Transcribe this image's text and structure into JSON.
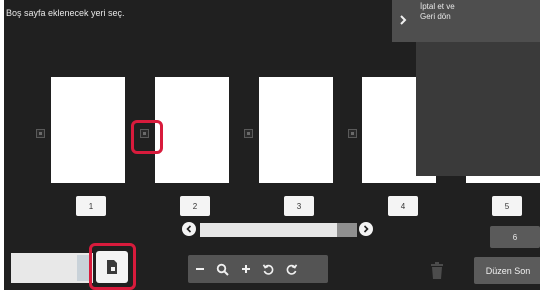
{
  "instruction": "Boş sayfa eklenecek yeri seç.",
  "cancel_panel": {
    "label": "İptal et ve\nGeri dön",
    "icon": "chevron-right-icon"
  },
  "pages": [
    {
      "number": "1"
    },
    {
      "number": "2"
    },
    {
      "number": "3"
    },
    {
      "number": "4"
    },
    {
      "number": "5"
    }
  ],
  "page6_button": "6",
  "done_button": "Düzen Son",
  "toolbar": {
    "icons": [
      "minus-icon",
      "zoom-icon",
      "plus-icon",
      "rotate-left-icon",
      "rotate-right-icon"
    ],
    "insert_icon": "blank-page-icon",
    "trash_icon": "trash-icon"
  },
  "colors": {
    "screen_bg": "#202020",
    "highlight": "#d81b3c",
    "panel_bg": "#4e4e4e"
  }
}
